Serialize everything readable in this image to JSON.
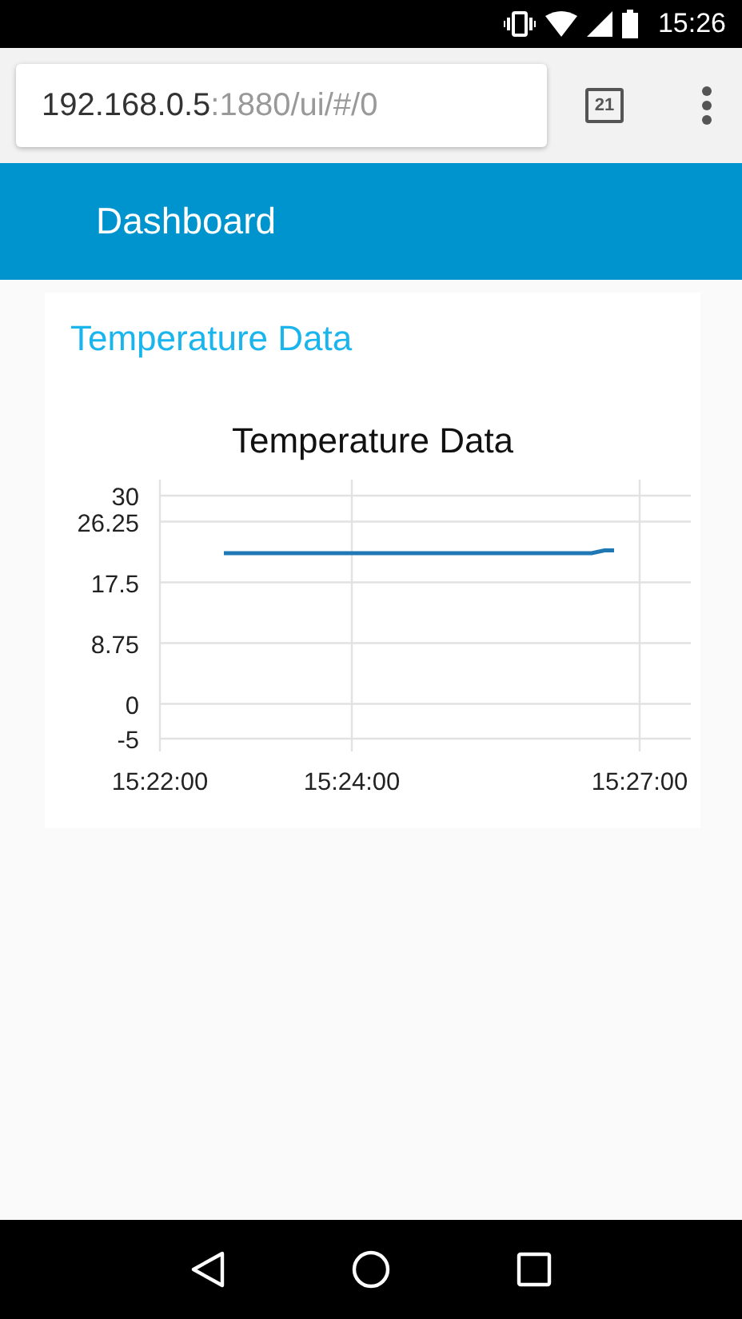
{
  "status_bar": {
    "time": "15:26"
  },
  "browser": {
    "url_host": "192.168.0.5",
    "url_path": ":1880/ui/#/0",
    "tab_count": "21"
  },
  "header": {
    "title": "Dashboard"
  },
  "card": {
    "title": "Temperature Data",
    "chart_data": {
      "type": "line",
      "title": "Temperature Data",
      "x": [
        55360,
        55590,
        55598,
        55604
      ],
      "series": [
        {
          "color": "#1f77b4",
          "values": [
            21.7,
            21.7,
            22.1,
            22.1
          ]
        }
      ],
      "xlim": [
        55320,
        55652
      ],
      "ylim": [
        -5,
        30
      ],
      "xticks": [
        {
          "value": 55320,
          "label": "15:22:00"
        },
        {
          "value": 55440,
          "label": "15:24:00"
        },
        {
          "value": 55620,
          "label": "15:27:00"
        }
      ],
      "yticks": [
        30,
        26.25,
        17.5,
        8.75,
        0,
        -5
      ],
      "grid": true
    }
  }
}
